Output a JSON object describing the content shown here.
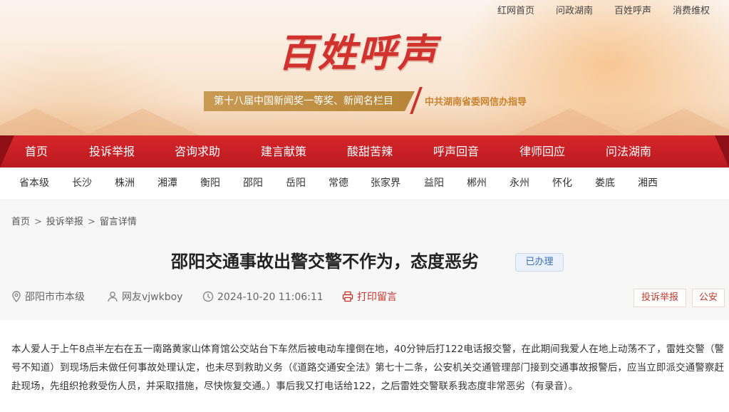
{
  "top_links": [
    "红网首页",
    "问政湖南",
    "百姓呼声",
    "消费维权"
  ],
  "logo_text": "百姓呼声",
  "award_text": "第十八届中国新闻奖一等奖、新闻名栏目",
  "guide_text": "中共湖南省委网信办指导",
  "main_nav": [
    "首页",
    "投诉举报",
    "咨询求助",
    "建言献策",
    "酸甜苦辣",
    "呼声回音",
    "律师回应",
    "问法湖南"
  ],
  "city_nav": [
    "省本级",
    "长沙",
    "株洲",
    "湘潭",
    "衡阳",
    "邵阳",
    "岳阳",
    "常德",
    "张家界",
    "益阳",
    "郴州",
    "永州",
    "怀化",
    "娄底",
    "湘西"
  ],
  "breadcrumb": [
    "首页",
    "投诉举报",
    "留言详情"
  ],
  "breadcrumb_sep": ">",
  "post": {
    "title": "邵阳交通事故出警交警不作为，态度恶劣",
    "status": "已办理",
    "location": "邵阳市市本级",
    "author": "网友vjwkboy",
    "time": "2024-10-20 11:06:11",
    "print_label": "打印留言",
    "tags": [
      "投诉举报",
      "公安"
    ],
    "body": "本人爱人于上午8点半左右在五一南路黄家山体育馆公交站台下车然后被电动车撞倒在地，40分钟后打122电话报交警，在此期间我爱人在地上动荡不了，雷姓交警（警号不知道）到现场后未做任何事故处理认定，也未尽到救助义务（《道路交通安全法》第七十二条，公安机关交通管理部门接到交通事故报警后，应当立即派交通警察赶赴现场，先组织抢救受伤人员，并采取措施，尽快恢复交通。）事后我又打电话给122，之后雷姓交警联系我态度非常恶劣（有录音）。"
  },
  "colors": {
    "nav_red": "#c8202a",
    "logo_red": "#d2322d",
    "award_gold": "#c0903f",
    "badge_blue": "#3a6fb5"
  }
}
